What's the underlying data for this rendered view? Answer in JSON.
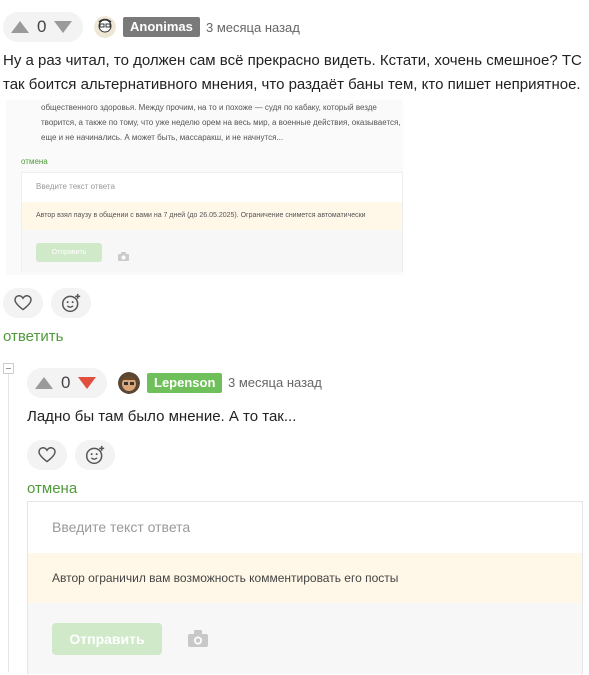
{
  "comment1": {
    "score": "0",
    "author": "Anonimas",
    "author_color": "#7a7a7a",
    "time": "3 месяца назад",
    "text": "Ну а раз читал, то должен сам всё прекрасно видеть. Кстати, хочень смешное? ТС так боится альтернативного мнения, что раздаёт баны тем, кто пишет неприятное.",
    "embedded": {
      "text": "общественного здоровья. Между прочим, на то и похоже — судя по кабаку, который везде творится, а также по тому, что уже неделю орем на весь мир, а военные действия, оказывается, еще и не начинались. А может быть, массаракш, и не начнутся...",
      "cancel": "отмена",
      "placeholder": "Введите текст ответа",
      "notice": "Автор взял паузу в общении с вами на 7 дней (до 26.05.2025). Ограничение снимется автоматически",
      "send": "Отправить"
    },
    "reply": "ответить"
  },
  "comment2": {
    "score": "0",
    "author": "Lepenson",
    "author_color": "#6fc05a",
    "time": "3 месяца назад",
    "text": "Ладно бы там было мнение. А то так...",
    "cancel": "отмена"
  },
  "reply_form": {
    "placeholder": "Введите текст ответа",
    "notice": "Автор ограничил вам возможность комментировать его посты",
    "send": "Отправить"
  },
  "icons": {
    "like": "heart-icon",
    "emoji": "emoji-add-icon",
    "camera": "camera-icon"
  }
}
